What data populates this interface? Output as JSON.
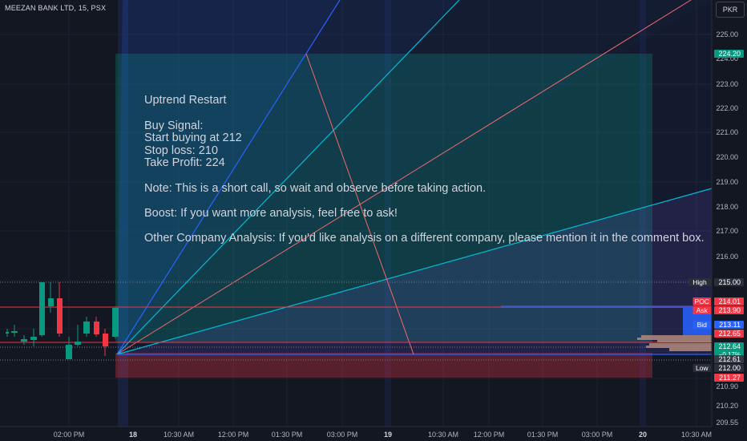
{
  "header": {
    "symbol_label": "MEEZAN BANK LTD, 15, PSX",
    "currency_button": "PKR"
  },
  "note": {
    "title": "Uptrend Restart",
    "buy_signal": "Buy Signal:",
    "entry": "Start buying at 212",
    "stop_loss": "Stop loss: 210",
    "take_profit": "Take Profit: 224",
    "short_call": "Note: This is a short call, so wait and observe before taking action.",
    "boost": "Boost: If you want more analysis, feel free to ask!",
    "other": "Other Company Analysis: If you'd like analysis on a different company, please mention it in the comment box."
  },
  "price_axis": {
    "ticks": [
      "225.00",
      "224.00",
      "223.00",
      "222.00",
      "221.00",
      "220.00",
      "219.00",
      "218.00",
      "217.00",
      "216.00",
      "212.00",
      "210.90",
      "210.20",
      "209.55"
    ],
    "labels": [
      {
        "name": "target",
        "text": "224.20",
        "price": 224.2,
        "color": "#089981"
      },
      {
        "name": "high",
        "tag": "High",
        "text": "215.00",
        "price": 215.0,
        "color": "#2a2e39"
      },
      {
        "name": "poc",
        "tag": "POC",
        "text": "214.01",
        "price": 214.01,
        "color": "#f23645"
      },
      {
        "name": "ask",
        "tag": "Ask",
        "text": "213.90",
        "price": 213.9,
        "color": "#f23645"
      },
      {
        "name": "bid",
        "tag": "Bid",
        "text": "213.11",
        "price": 213.11,
        "color": "#2962ff"
      },
      {
        "name": "entry",
        "text": "212.65",
        "price": 212.65,
        "color": "#f23645"
      },
      {
        "name": "last",
        "text": "212.64",
        "sub": "−0.17%",
        "price": 212.64,
        "color": "#089981"
      },
      {
        "name": "stop",
        "text": "212.61",
        "price": 212.61,
        "color": "#363a45"
      },
      {
        "name": "low",
        "tag": "Low",
        "text": "212.00",
        "price": 212.0,
        "color": "#2a2e39"
      },
      {
        "name": "loss",
        "text": "211.27",
        "price": 211.27,
        "color": "#f23645"
      }
    ]
  },
  "time_axis": [
    "02:00 PM",
    "18",
    "10:30 AM",
    "12:00 PM",
    "01:30 PM",
    "03:00 PM",
    "19",
    "10:30 AM",
    "12:00 PM",
    "01:30 PM",
    "03:00 PM",
    "20",
    "10:30 AM"
  ],
  "colors": {
    "up": "#089981",
    "down": "#f23645",
    "fan_blue": "#2962ff",
    "fan_cyan": "#00bcd4",
    "fan_red": "#f06a6a"
  }
}
